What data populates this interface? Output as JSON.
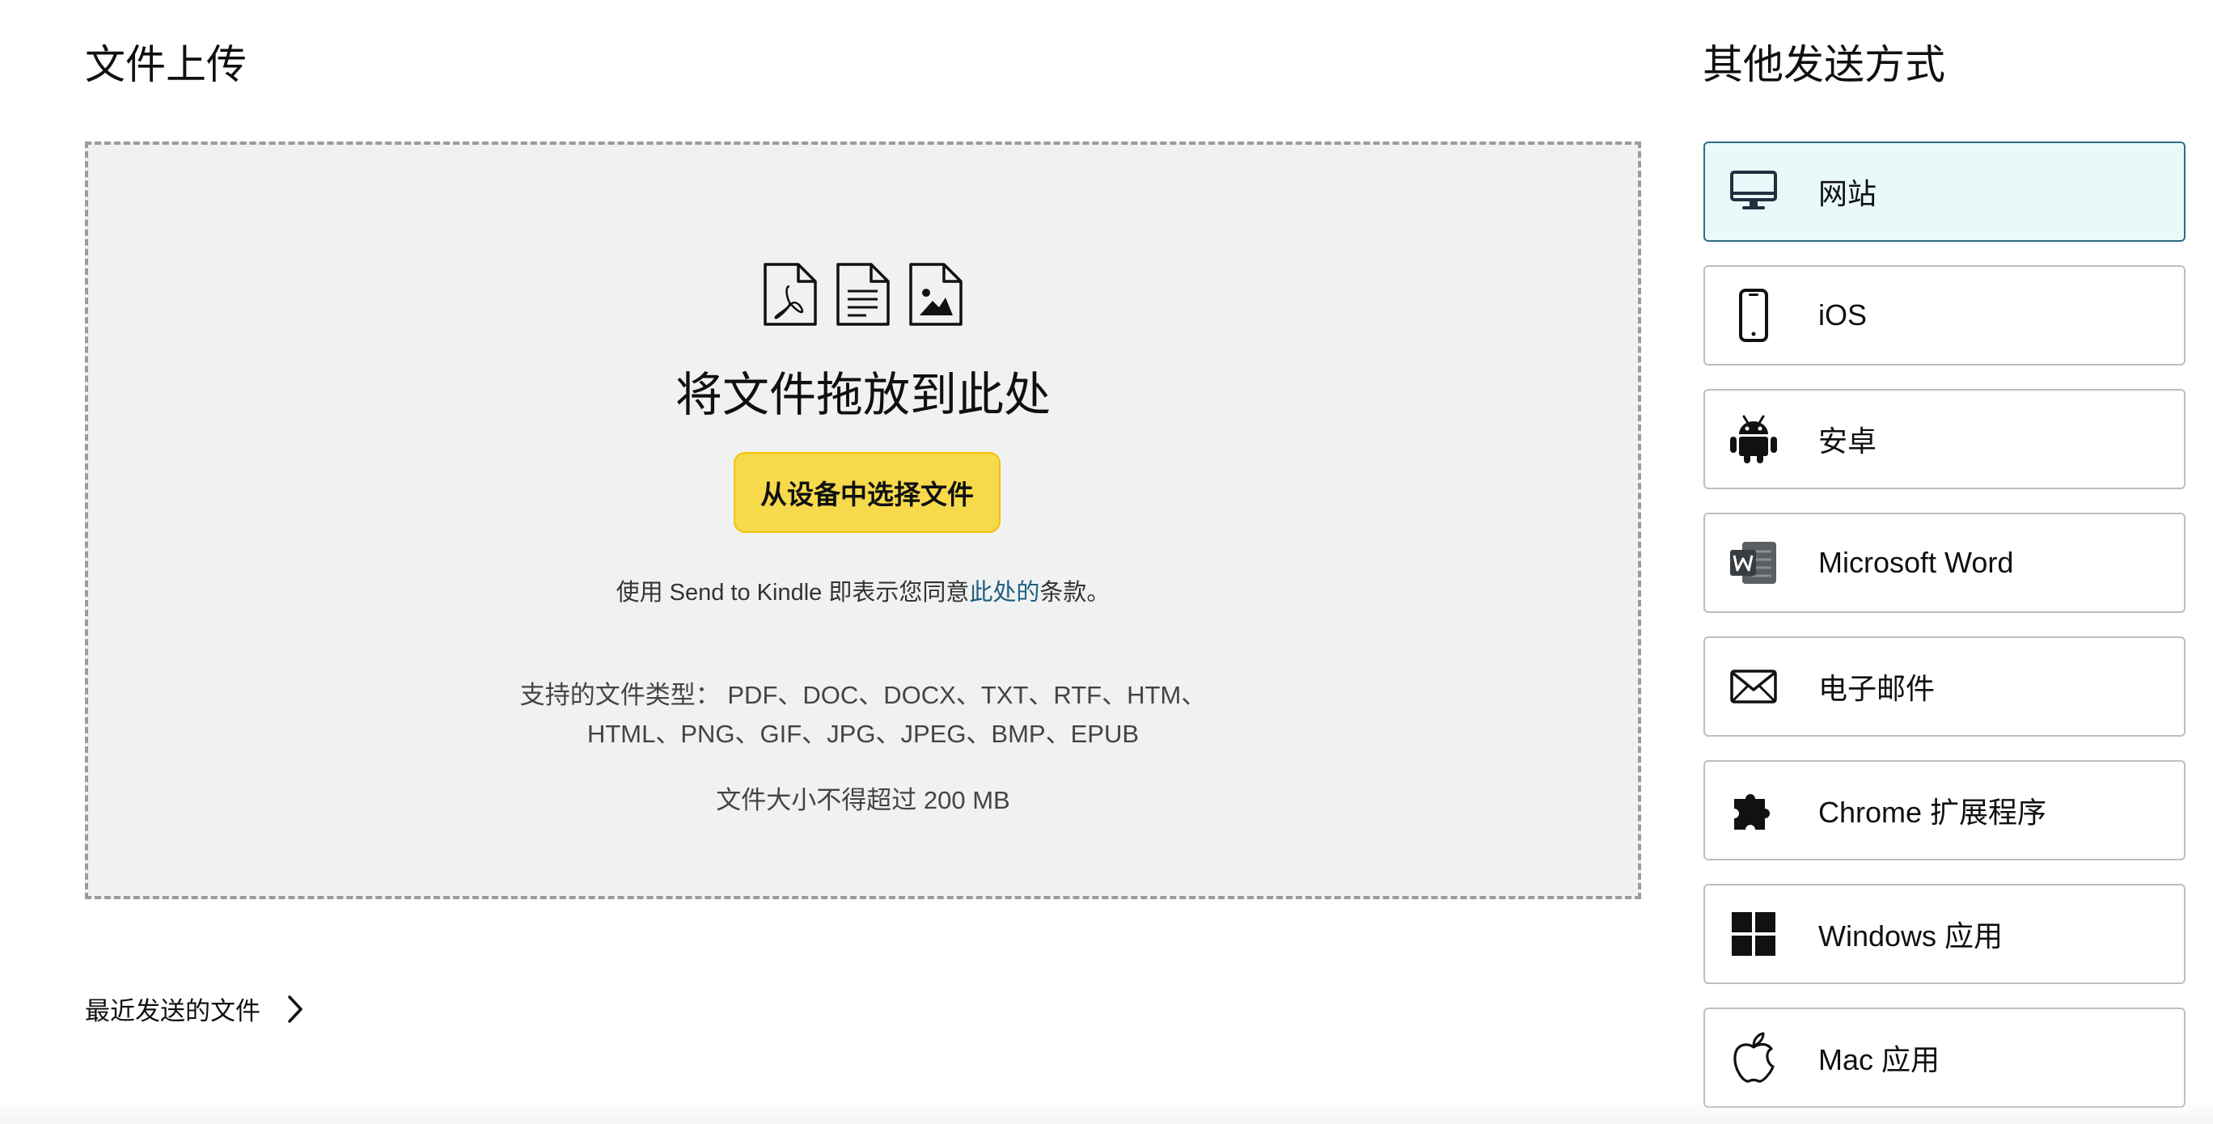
{
  "upload": {
    "title": "文件上传",
    "drop_heading": "将文件拖放到此处",
    "choose_button": "从设备中选择文件",
    "terms_prefix": "使用 Send to Kindle 即表示您同意",
    "terms_link": "此处的",
    "terms_suffix": "条款。",
    "types_line1": "支持的文件类型： PDF、DOC、DOCX、TXT、RTF、HTM、",
    "types_line2": "HTML、PNG、GIF、JPG、JPEG、BMP、EPUB",
    "size_limit": "文件大小不得超过 200 MB",
    "recent_link": "最近发送的文件"
  },
  "other": {
    "title": "其他发送方式",
    "methods": [
      {
        "label": "网站",
        "icon": "desktop-icon",
        "active": true
      },
      {
        "label": "iOS",
        "icon": "phone-icon"
      },
      {
        "label": "安卓",
        "icon": "android-icon"
      },
      {
        "label": "Microsoft Word",
        "icon": "word-icon"
      },
      {
        "label": "电子邮件",
        "icon": "mail-icon"
      },
      {
        "label": "Chrome 扩展程序",
        "icon": "puzzle-icon"
      },
      {
        "label": "Windows 应用",
        "icon": "windows-icon"
      },
      {
        "label": "Mac 应用",
        "icon": "apple-icon"
      }
    ]
  },
  "colors": {
    "button_yellow": "#f7d94c",
    "link_blue": "#1f5f80",
    "dropzone_bg": "#f0f2f2",
    "active_bg": "#e9f8f8"
  }
}
